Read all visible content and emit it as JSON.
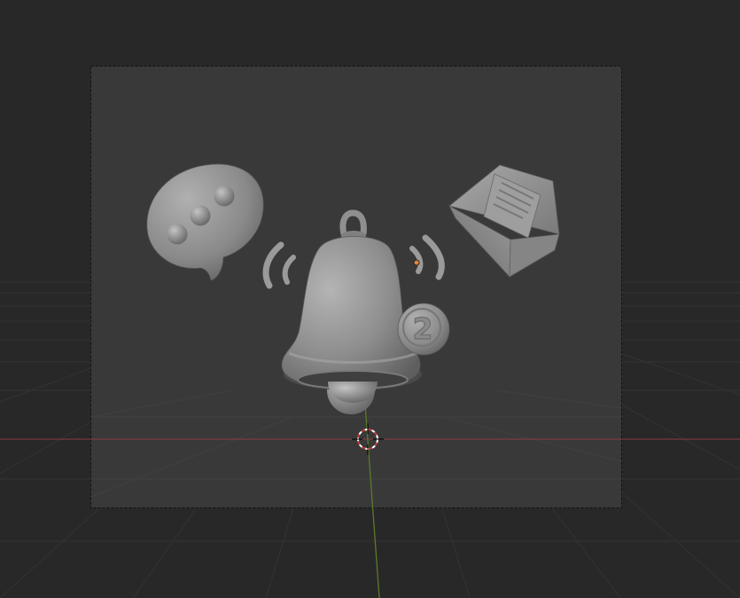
{
  "viewport": {
    "background_color": "#282828",
    "camera_frame_color": "#393939",
    "camera_frame_border": "#111111",
    "grid_line_color": "#333333",
    "x_axis_color": "#8a3a46",
    "y_axis_color": "#5b7a2c",
    "model_color": "#8f8f8f",
    "cursor_outer_color": "#ffffff",
    "cursor_inner_color": "#c23b3b",
    "origin_color": "#e8823c"
  },
  "objects": {
    "chat_bubble": {
      "icon": "chat-bubble-icon",
      "dot_count": 3
    },
    "bell": {
      "icon": "bell-icon"
    },
    "badge": {
      "icon": "notification-badge-icon",
      "count": "2"
    },
    "envelope": {
      "icon": "envelope-icon"
    },
    "left_waves": {
      "icon": "sound-waves-icon"
    },
    "right_waves": {
      "icon": "sound-waves-icon"
    }
  },
  "scene_elements": {
    "cursor_icon": "3d-cursor-icon",
    "origin_icon": "object-origin-icon"
  }
}
